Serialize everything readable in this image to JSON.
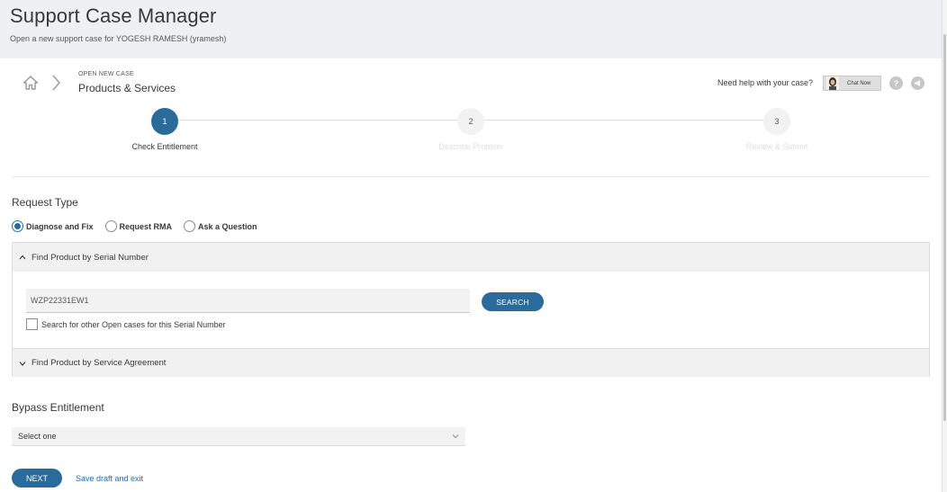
{
  "header": {
    "title": "Support Case Manager",
    "subtitle": "Open a new support case for YOGESH RAMESH (yramesh)"
  },
  "breadcrumb": {
    "label": "OPEN NEW CASE",
    "title": "Products & Services",
    "icons": [
      "home-icon",
      "chevron-right-icon"
    ]
  },
  "help": {
    "text": "Need help with your case?",
    "chat_label": "Chat Now",
    "question_icon": "?",
    "feedback_icon": "megaphone-icon"
  },
  "stepper": {
    "steps": [
      {
        "number": "1",
        "label": "Check Entitlement",
        "active": true
      },
      {
        "number": "2",
        "label": "Describe Problem",
        "active": false
      },
      {
        "number": "3",
        "label": "Review & Submit",
        "active": false
      }
    ]
  },
  "request_type": {
    "title": "Request Type",
    "options": [
      {
        "label": "Diagnose and Fix",
        "checked": true
      },
      {
        "label": "Request RMA",
        "checked": false
      },
      {
        "label": "Ask a Question",
        "checked": false
      }
    ]
  },
  "find_serial": {
    "title": "Find Product by Serial Number",
    "expanded": true,
    "serial_value": "WZP22331EW1",
    "search_label": "SEARCH",
    "checkbox_label": "Search for other Open cases for this Serial Number"
  },
  "find_agreement": {
    "title": "Find Product by Service Agreement",
    "expanded": false
  },
  "bypass": {
    "title": "Bypass Entitlement",
    "select_value": "Select one"
  },
  "footer": {
    "next_label": "NEXT",
    "draft_label": "Save draft and exit"
  },
  "colors": {
    "accent": "#2b6b9b",
    "header_bg": "#eff0f4",
    "panel_bg": "#f1f1f1"
  }
}
